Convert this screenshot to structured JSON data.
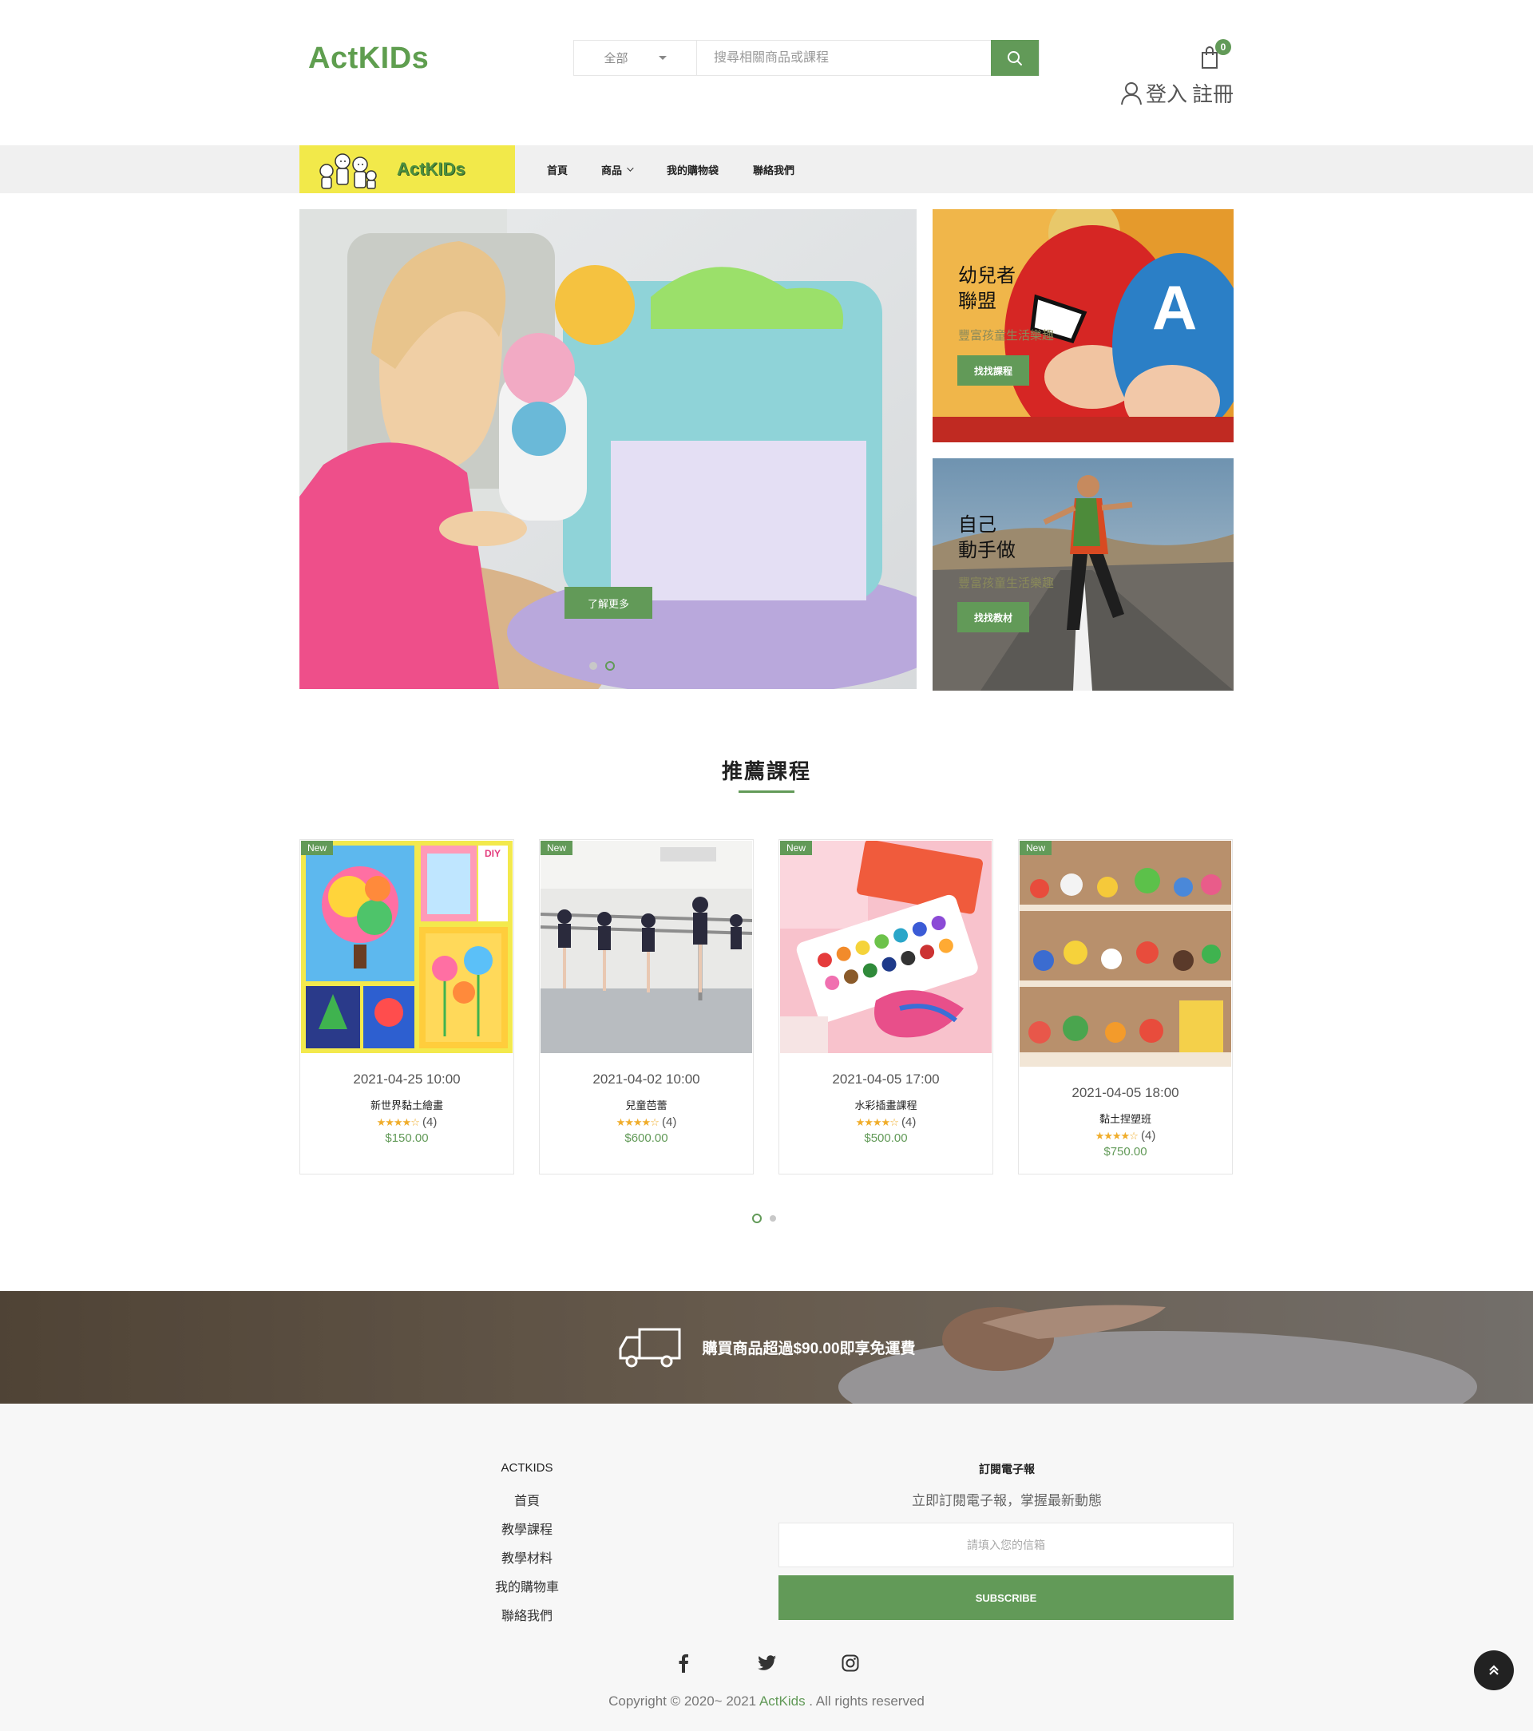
{
  "header": {
    "logo": "ActKIDs",
    "search": {
      "category": "全部",
      "placeholder": "搜尋相關商品或課程"
    },
    "cart_count": "0",
    "login": "登入",
    "register": "註冊"
  },
  "nav": {
    "brand": "ActKIDs",
    "items": [
      "首頁",
      "商品",
      "我的購物袋",
      "聯絡我們"
    ]
  },
  "hero": {
    "button": "了解更多",
    "slides": 2,
    "active_slide": 2
  },
  "promos": [
    {
      "title_line1": "幼兒者",
      "title_line2": "聯盟",
      "subtitle": "豐富孩童生活樂趣",
      "button": "找找課程"
    },
    {
      "title_line1": "自己",
      "title_line2": "動手做",
      "subtitle": "豐富孩童生活樂趣",
      "button": "找找教材"
    }
  ],
  "section": {
    "title": "推薦課程"
  },
  "products": [
    {
      "badge": "New",
      "date": "2021-04-25 10:00",
      "name": "新世界黏土繪畫",
      "stars": "★★★★☆",
      "reviews": "(4)",
      "price": "$150.00"
    },
    {
      "badge": "New",
      "date": "2021-04-02 10:00",
      "name": "兒童芭蕾",
      "stars": "★★★★☆",
      "reviews": "(4)",
      "price": "$600.00"
    },
    {
      "badge": "New",
      "date": "2021-04-05 17:00",
      "name": "水彩插畫課程",
      "stars": "★★★★☆",
      "reviews": "(4)",
      "price": "$500.00"
    },
    {
      "badge": "New",
      "date": "2021-04-05 18:00",
      "name": "黏土捏塑班",
      "stars": "★★★★☆",
      "reviews": "(4)",
      "price": "$750.00"
    }
  ],
  "product_carousel": {
    "pages": 2,
    "active_page": 1
  },
  "shipping": {
    "text": "購買商品超過$90.00即享免運費"
  },
  "footer": {
    "heading": "ACTKIDS",
    "links": [
      "首頁",
      "教學課程",
      "教學材料",
      "我的購物車",
      "聯絡我們"
    ],
    "newsletter": {
      "heading": "訂閱電子報",
      "subtitle": "立即訂閱電子報，掌握最新動態",
      "placeholder": "請填入您的信箱",
      "button": "SUBSCRIBE"
    },
    "social": [
      "facebook-icon",
      "twitter-icon",
      "instagram-icon"
    ],
    "copyright_prefix": "Copyright © 2020~ 2021 ",
    "copyright_brand": "ActKids",
    "copyright_suffix": " . All rights reserved"
  },
  "colors": {
    "accent": "#629a58",
    "nav_bg": "#f0f0f0",
    "nav_logo_bg": "#f2e94a",
    "footer_bg": "#f7f7f7"
  }
}
